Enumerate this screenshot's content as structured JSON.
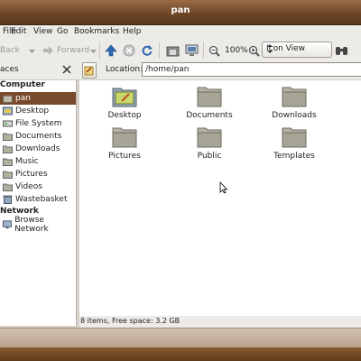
{
  "window": {
    "title": "pan"
  },
  "menu": [
    "File",
    "Edit",
    "View",
    "Go",
    "Bookmarks",
    "Help"
  ],
  "toolbar": {
    "back": "Back",
    "forward": "Forward",
    "zoom": "100%",
    "view_mode": "Icon View"
  },
  "location": {
    "label": "Location:",
    "path": "/home/pan"
  },
  "sidebar": {
    "places_label": "aces",
    "computer_label": "Computer",
    "items": [
      {
        "label": "pan",
        "selected": true,
        "icon": "home-folder-icon"
      },
      {
        "label": "Desktop",
        "icon": "desktop-icon"
      },
      {
        "label": "File System",
        "icon": "drive-icon"
      },
      {
        "label": "Documents",
        "icon": "folder-icon"
      },
      {
        "label": "Downloads",
        "icon": "folder-icon"
      },
      {
        "label": "Music",
        "icon": "folder-icon"
      },
      {
        "label": "Pictures",
        "icon": "folder-icon"
      },
      {
        "label": "Videos",
        "icon": "folder-icon"
      },
      {
        "label": "Wastebasket",
        "icon": "trash-icon"
      }
    ],
    "network_label": "Network",
    "network_items": [
      {
        "label": "Browse Network",
        "icon": "network-icon"
      }
    ]
  },
  "files": [
    {
      "label": "Desktop",
      "icon": "desktop-folder-icon"
    },
    {
      "label": "Documents",
      "icon": "folder-icon"
    },
    {
      "label": "Downloads",
      "icon": "folder-icon"
    },
    {
      "label": "Pictures",
      "icon": "folder-icon"
    },
    {
      "label": "Public",
      "icon": "folder-icon"
    },
    {
      "label": "Templates",
      "icon": "folder-icon"
    }
  ],
  "status": "8 items, Free space: 3.2 GB",
  "colors": {
    "accent": "#7a4a2c",
    "title_bar": "#6a4424"
  }
}
